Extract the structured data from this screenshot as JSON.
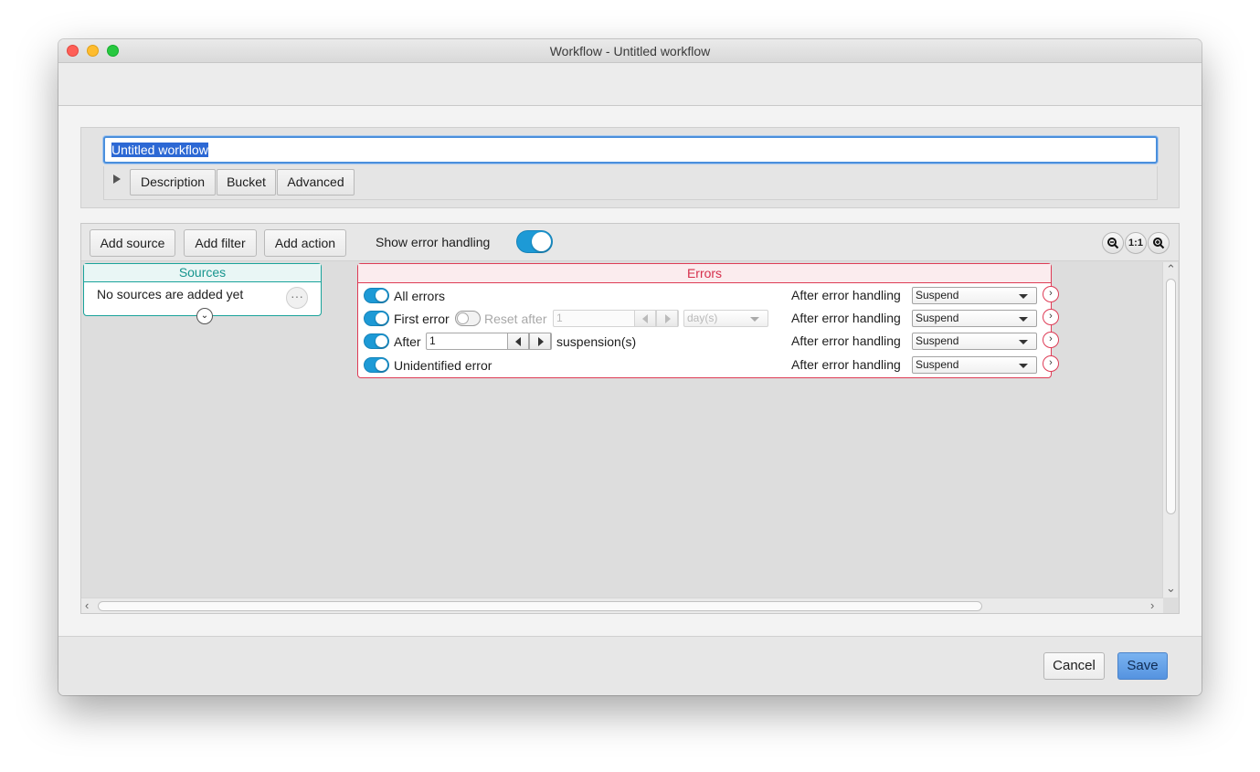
{
  "window": {
    "title": "Workflow - Untitled workflow"
  },
  "header": {
    "workflow_name": "Untitled workflow",
    "tabs": [
      {
        "label": "Description"
      },
      {
        "label": "Bucket"
      },
      {
        "label": "Advanced"
      }
    ]
  },
  "canvas_toolbar": {
    "add_source": "Add source",
    "add_filter": "Add filter",
    "add_action": "Add action",
    "show_error_handling_label": "Show error handling",
    "show_error_handling_on": true,
    "zoom_out_icon": "zoom-out-icon",
    "zoom_reset_label": "1:1",
    "zoom_in_icon": "zoom-in-icon"
  },
  "sources": {
    "title": "Sources",
    "empty_text": "No sources are added yet",
    "more_label": "···"
  },
  "errors": {
    "title": "Errors",
    "after_label": "After error handling",
    "rows": [
      {
        "label": "All errors",
        "enabled": true,
        "action": "Suspend"
      },
      {
        "label": "First error",
        "enabled": true,
        "action": "Suspend",
        "reset_label": "Reset after",
        "reset_enabled": false,
        "reset_value": "1",
        "reset_unit": "day(s)"
      },
      {
        "label": "After",
        "enabled": true,
        "action": "Suspend",
        "count_value": "1",
        "suffix": "suspension(s)"
      },
      {
        "label": "Unidentified error",
        "enabled": true,
        "action": "Suspend"
      }
    ]
  },
  "footer": {
    "cancel": "Cancel",
    "save": "Save"
  },
  "colors": {
    "accent": "#1d9ad6",
    "sources_border": "#1aa39b",
    "errors_border": "#de3c56",
    "save_button": "#5593e0"
  }
}
